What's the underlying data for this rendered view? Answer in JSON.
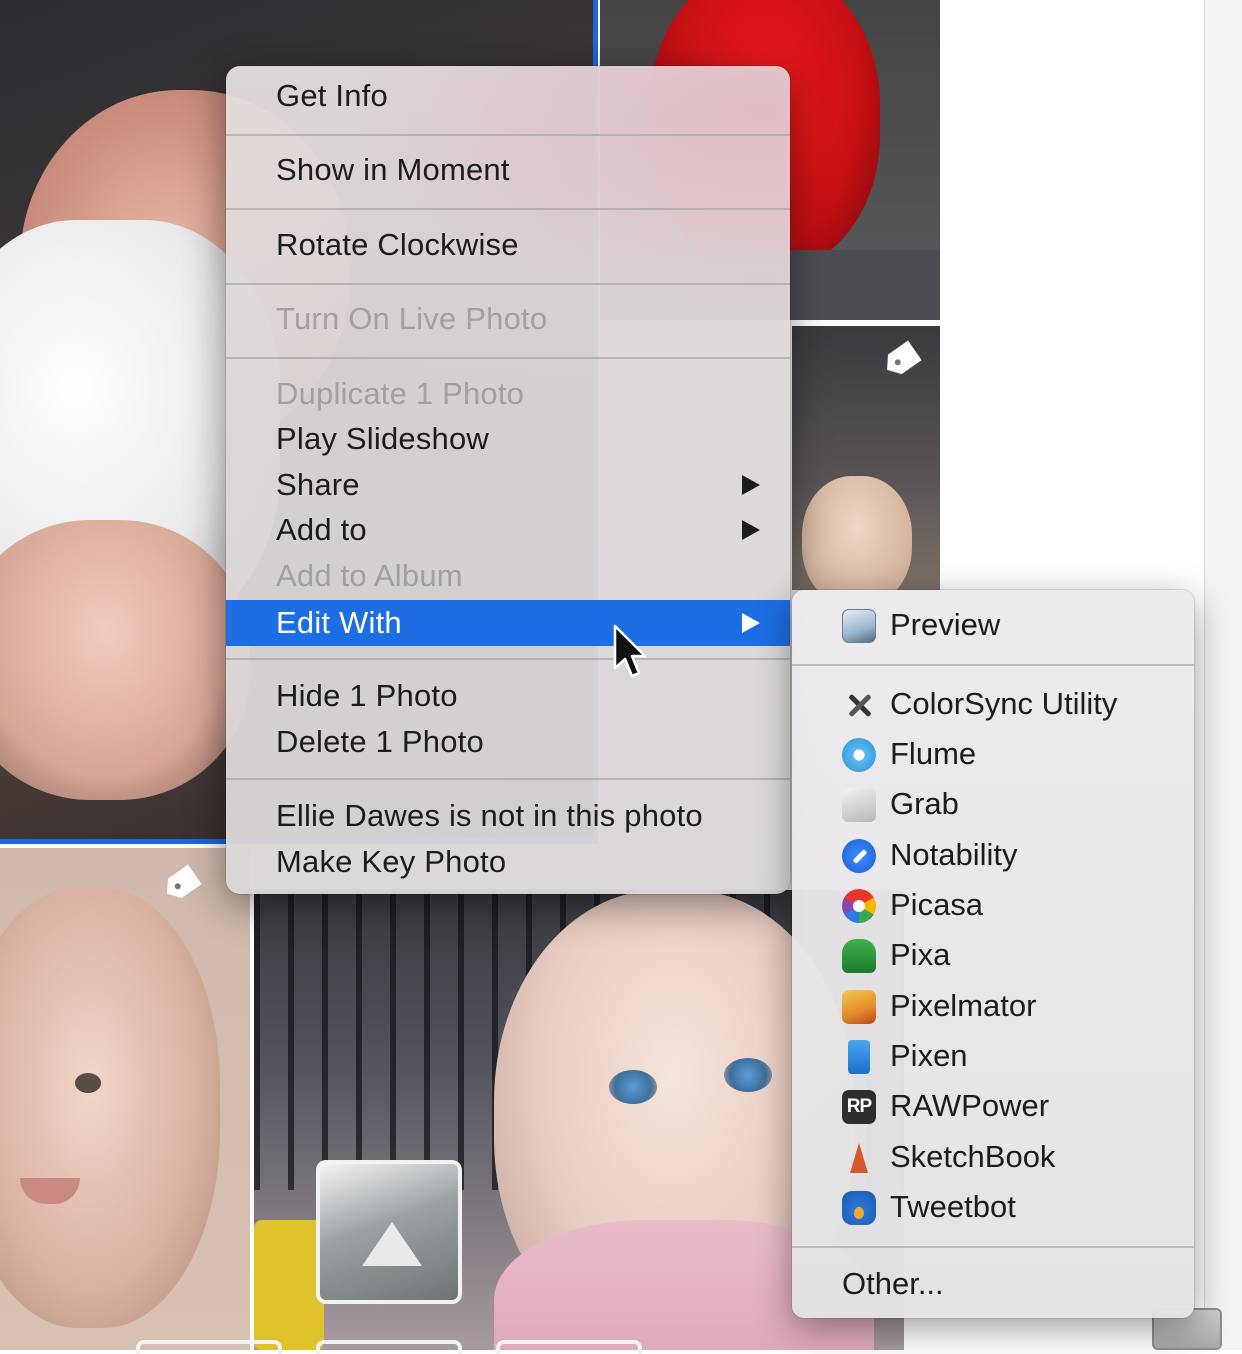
{
  "context_menu": {
    "items": [
      {
        "label": "Get Info"
      },
      {
        "label": "Show in Moment"
      },
      {
        "label": "Rotate Clockwise"
      },
      {
        "label": "Turn On Live Photo"
      },
      {
        "label": "Duplicate 1 Photo"
      },
      {
        "label": "Play Slideshow"
      },
      {
        "label": "Share"
      },
      {
        "label": "Add to"
      },
      {
        "label": "Add to Album"
      },
      {
        "label": "Edit With"
      },
      {
        "label": "Hide 1 Photo"
      },
      {
        "label": "Delete 1 Photo"
      },
      {
        "label": "Ellie Dawes is not in this photo"
      },
      {
        "label": "Make Key Photo"
      }
    ]
  },
  "edit_with_submenu": {
    "items": [
      {
        "label": "Preview",
        "icon": "preview-icon"
      },
      {
        "label": "ColorSync Utility",
        "icon": "colorsync-utility-icon"
      },
      {
        "label": "Flume",
        "icon": "flume-icon"
      },
      {
        "label": "Grab",
        "icon": "grab-icon"
      },
      {
        "label": "Notability",
        "icon": "notability-icon"
      },
      {
        "label": "Picasa",
        "icon": "picasa-icon"
      },
      {
        "label": "Pixa",
        "icon": "pixa-icon"
      },
      {
        "label": "Pixelmator",
        "icon": "pixelmator-icon"
      },
      {
        "label": "Pixen",
        "icon": "pixen-icon"
      },
      {
        "label": "RAWPower",
        "icon": "rawpower-icon",
        "icon_text": "RP"
      },
      {
        "label": "SketchBook",
        "icon": "sketchbook-icon"
      },
      {
        "label": "Tweetbot",
        "icon": "tweetbot-icon"
      },
      {
        "label": "Other..."
      }
    ]
  },
  "colors": {
    "selection_highlight": "#1d6ee3",
    "photo_selection_border": "#1c66e0",
    "disabled_text": "#a3a0a0"
  }
}
